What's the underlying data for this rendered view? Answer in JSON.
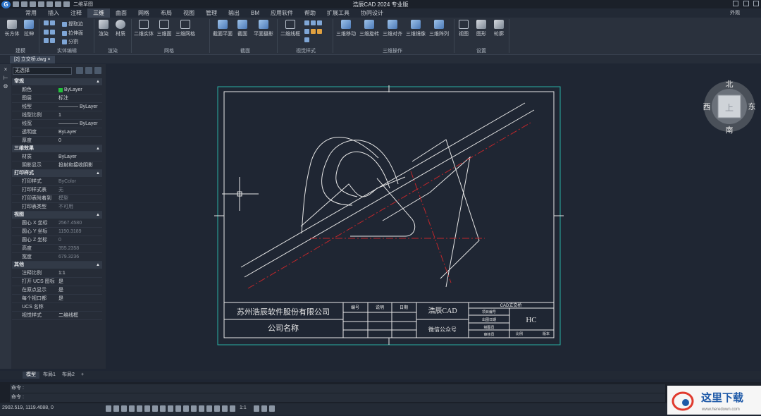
{
  "app": {
    "title": "浩辰CAD 2024 专业版",
    "logo": "G",
    "workspace": "二维草图"
  },
  "menu": [
    "常用",
    "插入",
    "注释",
    "三维",
    "曲面",
    "网格",
    "布局",
    "视图",
    "管理",
    "输出",
    "BM",
    "应用软件",
    "帮助",
    "扩展工具",
    "协同设计"
  ],
  "menu_active": "三维",
  "appearance_label": "外观",
  "ribbon": {
    "buttons": {
      "box": "长方体",
      "extrude": "拉伸",
      "extract_edge": "提取边",
      "extrude_face": "拉伸面",
      "slice": "分割",
      "render": "渲染",
      "material": "材质",
      "solid_2d": "二维实体",
      "surface_3d": "三维面",
      "mesh_3d": "三维网格",
      "section_plane": "截面平面",
      "section": "截面",
      "flatshot": "平面摄影",
      "wireframe_2d": "二维线框",
      "move_3d": "三维移动",
      "rotate_3d": "三维旋转",
      "align_3d": "三维对齐",
      "mirror_3d": "三维镜像",
      "array_3d": "三维阵列",
      "view": "视图",
      "graphics": "图形",
      "outline": "轮廓"
    },
    "groups": [
      "建模",
      "实体编辑",
      "渲染",
      "网格",
      "截面",
      "视觉样式",
      "三维操作",
      "设置"
    ]
  },
  "document_tab": "[2] 立交桥.dwg",
  "palette": {
    "selection": "无选择",
    "sections": [
      {
        "title": "常规",
        "rows": [
          {
            "k": "颜色",
            "v": "ByLayer"
          },
          {
            "k": "图层",
            "v": "标注"
          },
          {
            "k": "线型",
            "v": "———— ByLayer"
          },
          {
            "k": "线型比例",
            "v": "1"
          },
          {
            "k": "线宽",
            "v": "———— ByLayer"
          },
          {
            "k": "透明度",
            "v": "ByLayer"
          },
          {
            "k": "厚度",
            "v": "0"
          }
        ]
      },
      {
        "title": "三维效果",
        "rows": [
          {
            "k": "材质",
            "v": "ByLayer"
          },
          {
            "k": "阴影显示",
            "v": "投射和接收阴影"
          }
        ]
      },
      {
        "title": "打印样式",
        "rows": [
          {
            "k": "打印样式",
            "v": "ByColor"
          },
          {
            "k": "打印样式表",
            "v": "无"
          },
          {
            "k": "打印表附着到",
            "v": "模型"
          },
          {
            "k": "打印表类型",
            "v": "不可用"
          }
        ]
      },
      {
        "title": "视图",
        "rows": [
          {
            "k": "圆心 X 坐标",
            "v": "2567.4580"
          },
          {
            "k": "圆心 Y 坐标",
            "v": "1150.3189"
          },
          {
            "k": "圆心 Z 坐标",
            "v": "0"
          },
          {
            "k": "高度",
            "v": "355.2358"
          },
          {
            "k": "宽度",
            "v": "679.3236"
          }
        ]
      },
      {
        "title": "其他",
        "rows": [
          {
            "k": "注释比例",
            "v": "1:1"
          },
          {
            "k": "打开 UCS 图标",
            "v": "是"
          },
          {
            "k": "在原点显示",
            "v": "是"
          },
          {
            "k": "每个视口都",
            "v": "是"
          },
          {
            "k": "UCS 名称",
            "v": ""
          },
          {
            "k": "视觉样式",
            "v": "二维线框"
          }
        ]
      }
    ]
  },
  "drawing": {
    "company": "苏州浩辰软件股份有限公司",
    "company_name_label": "公司名称",
    "col_number": "编号",
    "col_desc": "说明",
    "col_date": "日期",
    "brand": "浩辰CAD",
    "wechat": "微信公众号",
    "sheet_title": "CAD立交桥",
    "code": "HC",
    "project_no": "项目编号",
    "date_label": "出图日期",
    "drawn_by": "制图员",
    "reviewed_by": "审核员",
    "scale_label": "比例",
    "version_label": "版本"
  },
  "viewcube": {
    "north": "北",
    "south": "南",
    "east": "东",
    "west": "西",
    "top": "上"
  },
  "layout_tabs": [
    "模型",
    "布局1",
    "布局2",
    "+"
  ],
  "command": {
    "line1": "命令 :",
    "line2": "命令 :"
  },
  "status": {
    "coords": "2902.519, 1119.4088, 0",
    "scale": "1:1"
  },
  "watermark": {
    "text": "这里下载",
    "url": "www.heredown.com"
  }
}
